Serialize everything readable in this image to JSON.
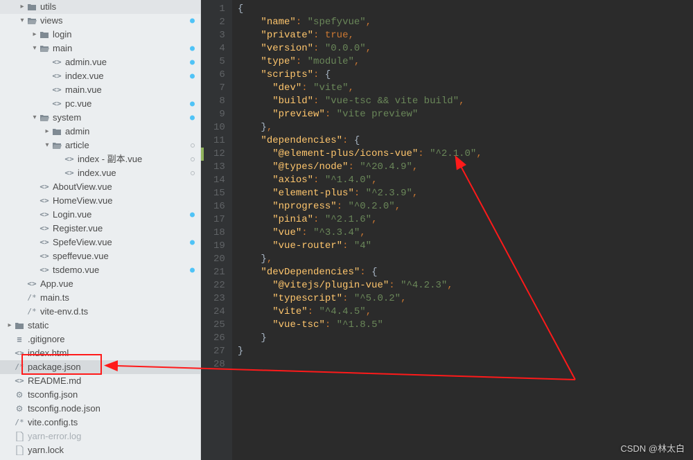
{
  "watermark": "CSDN @林太白",
  "sidebar": {
    "items": [
      {
        "depth": 1,
        "chev": "right",
        "icon": "folder",
        "label": "utils",
        "dim": false
      },
      {
        "depth": 1,
        "chev": "down",
        "icon": "folder-open",
        "label": "views",
        "dim": false,
        "dot": "solid"
      },
      {
        "depth": 2,
        "chev": "right",
        "icon": "folder",
        "label": "login",
        "dim": false
      },
      {
        "depth": 2,
        "chev": "down",
        "icon": "folder-open",
        "label": "main",
        "dim": false,
        "dot": "solid"
      },
      {
        "depth": 3,
        "chev": "",
        "icon": "code",
        "label": "admin.vue",
        "dim": false,
        "dot": "solid"
      },
      {
        "depth": 3,
        "chev": "",
        "icon": "code",
        "label": "index.vue",
        "dim": false,
        "dot": "solid"
      },
      {
        "depth": 3,
        "chev": "",
        "icon": "code",
        "label": "main.vue",
        "dim": false
      },
      {
        "depth": 3,
        "chev": "",
        "icon": "code",
        "label": "pc.vue",
        "dim": false,
        "dot": "solid"
      },
      {
        "depth": 2,
        "chev": "down",
        "icon": "folder-open",
        "label": "system",
        "dim": false,
        "dot": "solid"
      },
      {
        "depth": 3,
        "chev": "right",
        "icon": "folder",
        "label": "admin",
        "dim": false
      },
      {
        "depth": 3,
        "chev": "down",
        "icon": "folder-open",
        "label": "article",
        "dim": false,
        "dot": "hollow"
      },
      {
        "depth": 4,
        "chev": "",
        "icon": "code",
        "label": "index - 副本.vue",
        "dim": false,
        "dot": "hollow"
      },
      {
        "depth": 4,
        "chev": "",
        "icon": "code",
        "label": "index.vue",
        "dim": false,
        "dot": "hollow"
      },
      {
        "depth": 2,
        "chev": "",
        "icon": "code",
        "label": "AboutView.vue",
        "dim": false
      },
      {
        "depth": 2,
        "chev": "",
        "icon": "code",
        "label": "HomeView.vue",
        "dim": false
      },
      {
        "depth": 2,
        "chev": "",
        "icon": "code",
        "label": "Login.vue",
        "dim": false,
        "dot": "solid"
      },
      {
        "depth": 2,
        "chev": "",
        "icon": "code",
        "label": "Register.vue",
        "dim": false
      },
      {
        "depth": 2,
        "chev": "",
        "icon": "code",
        "label": "SpefeView.vue",
        "dim": false,
        "dot": "solid"
      },
      {
        "depth": 2,
        "chev": "",
        "icon": "code",
        "label": "speffevue.vue",
        "dim": false
      },
      {
        "depth": 2,
        "chev": "",
        "icon": "code",
        "label": "tsdemo.vue",
        "dim": false,
        "dot": "solid"
      },
      {
        "depth": 1,
        "chev": "",
        "icon": "code",
        "label": "App.vue",
        "dim": false
      },
      {
        "depth": 1,
        "chev": "",
        "icon": "comment",
        "label": "main.ts",
        "dim": false
      },
      {
        "depth": 1,
        "chev": "",
        "icon": "comment",
        "label": "vite-env.d.ts",
        "dim": false
      },
      {
        "depth": 0,
        "chev": "right",
        "icon": "folder",
        "label": "static",
        "dim": false
      },
      {
        "depth": 0,
        "chev": "",
        "icon": "equals",
        "label": ".gitignore",
        "dim": false
      },
      {
        "depth": 0,
        "chev": "",
        "icon": "code",
        "label": "index.html",
        "dim": false
      },
      {
        "depth": 0,
        "chev": "",
        "icon": "comment",
        "label": "package.json",
        "dim": false,
        "selected": true,
        "boxed": true
      },
      {
        "depth": 0,
        "chev": "",
        "icon": "code",
        "label": "README.md",
        "dim": false
      },
      {
        "depth": 0,
        "chev": "",
        "icon": "gear",
        "label": "tsconfig.json",
        "dim": false
      },
      {
        "depth": 0,
        "chev": "",
        "icon": "gear",
        "label": "tsconfig.node.json",
        "dim": false
      },
      {
        "depth": 0,
        "chev": "",
        "icon": "comment",
        "label": "vite.config.ts",
        "dim": false
      },
      {
        "depth": 0,
        "chev": "",
        "icon": "file",
        "label": "yarn-error.log",
        "dim": true
      },
      {
        "depth": 0,
        "chev": "",
        "icon": "file",
        "label": "yarn.lock",
        "dim": false
      }
    ]
  },
  "editor": {
    "lines": [
      {
        "n": 1,
        "seg": [
          [
            "br",
            "{"
          ]
        ]
      },
      {
        "n": 2,
        "ind": 1,
        "seg": [
          [
            "key",
            "\"name\""
          ],
          [
            "p",
            ": "
          ],
          [
            "str",
            "\"spefyvue\""
          ],
          [
            "p",
            ","
          ]
        ]
      },
      {
        "n": 3,
        "ind": 1,
        "seg": [
          [
            "key",
            "\"private\""
          ],
          [
            "p",
            ": "
          ],
          [
            "bool",
            "true"
          ],
          [
            "p",
            ","
          ]
        ]
      },
      {
        "n": 4,
        "ind": 1,
        "seg": [
          [
            "key",
            "\"version\""
          ],
          [
            "p",
            ": "
          ],
          [
            "str",
            "\"0.0.0\""
          ],
          [
            "p",
            ","
          ]
        ]
      },
      {
        "n": 5,
        "ind": 1,
        "seg": [
          [
            "key",
            "\"type\""
          ],
          [
            "p",
            ": "
          ],
          [
            "str",
            "\"module\""
          ],
          [
            "p",
            ","
          ]
        ]
      },
      {
        "n": 6,
        "ind": 1,
        "seg": [
          [
            "key",
            "\"scripts\""
          ],
          [
            "p",
            ": "
          ],
          [
            "br",
            "{"
          ]
        ]
      },
      {
        "n": 7,
        "ind": 2,
        "seg": [
          [
            "key",
            "\"dev\""
          ],
          [
            "p",
            ": "
          ],
          [
            "str",
            "\"vite\""
          ],
          [
            "p",
            ","
          ]
        ]
      },
      {
        "n": 8,
        "ind": 2,
        "seg": [
          [
            "key",
            "\"build\""
          ],
          [
            "p",
            ": "
          ],
          [
            "str",
            "\"vue-tsc && vite build\""
          ],
          [
            "p",
            ","
          ]
        ]
      },
      {
        "n": 9,
        "ind": 2,
        "seg": [
          [
            "key",
            "\"preview\""
          ],
          [
            "p",
            ": "
          ],
          [
            "str",
            "\"vite preview\""
          ]
        ]
      },
      {
        "n": 10,
        "ind": 1,
        "seg": [
          [
            "br",
            "}"
          ],
          [
            "p",
            ","
          ]
        ]
      },
      {
        "n": 11,
        "ind": 1,
        "seg": [
          [
            "key",
            "\"dependencies\""
          ],
          [
            "p",
            ": "
          ],
          [
            "br",
            "{"
          ]
        ]
      },
      {
        "n": 12,
        "ind": 2,
        "seg": [
          [
            "key",
            "\"@element-plus/icons-vue\""
          ],
          [
            "p",
            ": "
          ],
          [
            "str",
            "\"^2.1.0\""
          ],
          [
            "p",
            ","
          ]
        ],
        "mark": true
      },
      {
        "n": 13,
        "ind": 2,
        "seg": [
          [
            "key",
            "\"@types/node\""
          ],
          [
            "p",
            ": "
          ],
          [
            "str",
            "\"^20.4.9\""
          ],
          [
            "p",
            ","
          ]
        ]
      },
      {
        "n": 14,
        "ind": 2,
        "seg": [
          [
            "key",
            "\"axios\""
          ],
          [
            "p",
            ": "
          ],
          [
            "str",
            "\"^1.4.0\""
          ],
          [
            "p",
            ","
          ]
        ]
      },
      {
        "n": 15,
        "ind": 2,
        "seg": [
          [
            "key",
            "\"element-plus\""
          ],
          [
            "p",
            ": "
          ],
          [
            "str",
            "\"^2.3.9\""
          ],
          [
            "p",
            ","
          ]
        ]
      },
      {
        "n": 16,
        "ind": 2,
        "seg": [
          [
            "key",
            "\"nprogress\""
          ],
          [
            "p",
            ": "
          ],
          [
            "str",
            "\"^0.2.0\""
          ],
          [
            "p",
            ","
          ]
        ]
      },
      {
        "n": 17,
        "ind": 2,
        "seg": [
          [
            "key",
            "\"pinia\""
          ],
          [
            "p",
            ": "
          ],
          [
            "str",
            "\"^2.1.6\""
          ],
          [
            "p",
            ","
          ]
        ]
      },
      {
        "n": 18,
        "ind": 2,
        "seg": [
          [
            "key",
            "\"vue\""
          ],
          [
            "p",
            ": "
          ],
          [
            "str",
            "\"^3.3.4\""
          ],
          [
            "p",
            ","
          ]
        ]
      },
      {
        "n": 19,
        "ind": 2,
        "seg": [
          [
            "key",
            "\"vue-router\""
          ],
          [
            "p",
            ": "
          ],
          [
            "str",
            "\"4\""
          ]
        ]
      },
      {
        "n": 20,
        "ind": 1,
        "seg": [
          [
            "br",
            "}"
          ],
          [
            "p",
            ","
          ]
        ]
      },
      {
        "n": 21,
        "ind": 1,
        "seg": [
          [
            "key",
            "\"devDependencies\""
          ],
          [
            "p",
            ": "
          ],
          [
            "br",
            "{"
          ]
        ]
      },
      {
        "n": 22,
        "ind": 2,
        "seg": [
          [
            "key",
            "\"@vitejs/plugin-vue\""
          ],
          [
            "p",
            ": "
          ],
          [
            "str",
            "\"^4.2.3\""
          ],
          [
            "p",
            ","
          ]
        ]
      },
      {
        "n": 23,
        "ind": 2,
        "seg": [
          [
            "key",
            "\"typescript\""
          ],
          [
            "p",
            ": "
          ],
          [
            "str",
            "\"^5.0.2\""
          ],
          [
            "p",
            ","
          ]
        ]
      },
      {
        "n": 24,
        "ind": 2,
        "seg": [
          [
            "key",
            "\"vite\""
          ],
          [
            "p",
            ": "
          ],
          [
            "str",
            "\"^4.4.5\""
          ],
          [
            "p",
            ","
          ]
        ]
      },
      {
        "n": 25,
        "ind": 2,
        "seg": [
          [
            "key",
            "\"vue-tsc\""
          ],
          [
            "p",
            ": "
          ],
          [
            "str",
            "\"^1.8.5\""
          ]
        ]
      },
      {
        "n": 26,
        "ind": 1,
        "seg": [
          [
            "br",
            "}"
          ]
        ]
      },
      {
        "n": 27,
        "ind": 0,
        "seg": [
          [
            "br",
            "}"
          ]
        ]
      },
      {
        "n": 28,
        "ind": 0,
        "seg": []
      }
    ]
  }
}
